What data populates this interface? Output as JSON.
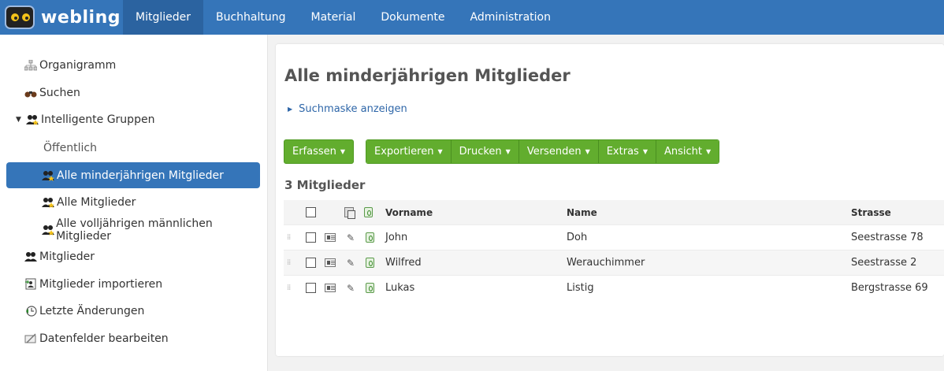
{
  "app": {
    "logo_text": "webling"
  },
  "nav": [
    {
      "label": "Mitglieder",
      "active": true
    },
    {
      "label": "Buchhaltung"
    },
    {
      "label": "Material"
    },
    {
      "label": "Dokumente"
    },
    {
      "label": "Administration"
    }
  ],
  "sidebar": {
    "items": [
      {
        "label": "Organigramm",
        "icon": "org-chart-icon"
      },
      {
        "label": "Suchen",
        "icon": "binoculars-icon"
      },
      {
        "label": "Intelligente Gruppen",
        "icon": "smart-group-icon"
      },
      {
        "label": "Öffentlich"
      },
      {
        "label": "Alle minderjährigen Mitglieder",
        "icon": "smart-group-icon"
      },
      {
        "label": "Alle Mitglieder",
        "icon": "smart-group-icon"
      },
      {
        "label": "Alle volljährigen männlichen Mitglieder",
        "icon": "smart-group-icon"
      },
      {
        "label": "Mitglieder",
        "icon": "members-icon"
      },
      {
        "label": "Mitglieder importieren",
        "icon": "import-icon"
      },
      {
        "label": "Letzte Änderungen",
        "icon": "history-icon"
      },
      {
        "label": "Datenfelder bearbeiten",
        "icon": "edit-fields-icon"
      }
    ]
  },
  "main": {
    "title": "Alle minderjährigen Mitglieder",
    "search_toggle": "Suchmaske anzeigen",
    "buttons": {
      "erfassen": "Erfassen",
      "exportieren": "Exportieren",
      "drucken": "Drucken",
      "versenden": "Versenden",
      "extras": "Extras",
      "ansicht": "Ansicht"
    },
    "count": "3 Mitglieder",
    "table": {
      "columns": {
        "vorname": "Vorname",
        "name": "Name",
        "strasse": "Strasse"
      },
      "rows": [
        {
          "vorname": "John",
          "name": "Doh",
          "strasse": "Seestrasse 78"
        },
        {
          "vorname": "Wilfred",
          "name": "Werauchimmer",
          "strasse": "Seestrasse 2"
        },
        {
          "vorname": "Lukas",
          "name": "Listig",
          "strasse": "Bergstrasse 69"
        }
      ]
    }
  },
  "colors": {
    "accent": "#3575b9",
    "nav_active": "#2b63a0",
    "button_green": "#62ad2e"
  }
}
